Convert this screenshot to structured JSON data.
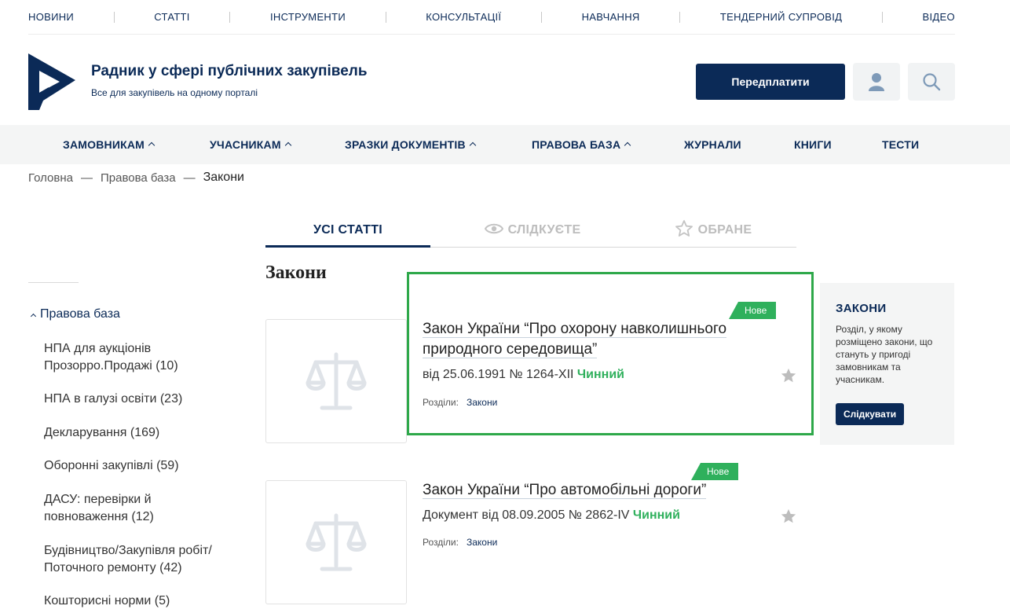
{
  "topnav": [
    "НОВИНИ",
    "СТАТТІ",
    "ІНСТРУМЕНТИ",
    "КОНСУЛЬТАЦІЇ",
    "НАВЧАННЯ",
    "ТЕНДЕРНИЙ СУПРОВІД",
    "ВІДЕО"
  ],
  "header": {
    "title": "Радник у сфері публічних закупівель",
    "subtitle": "Все для закупівель на одному порталі",
    "subscribe_label": "Передплатити"
  },
  "mainnav": [
    "ЗАМОВНИКАМ",
    "УЧАСНИКАМ",
    "ЗРАЗКИ ДОКУМЕНТІВ",
    "ПРАВОВА БАЗА",
    "ЖУРНАЛИ",
    "КНИГИ",
    "ТЕСТИ"
  ],
  "breadcrumb": {
    "home": "Головна",
    "section": "Правова база",
    "current": "Закони",
    "separator": "—"
  },
  "tabs": {
    "all": "УСІ СТАТТІ",
    "following": "СЛІДКУЄТЕ",
    "favorites": "ОБРАНЕ"
  },
  "section_title": "Закони",
  "sidebar": {
    "root": "Правова база",
    "items": [
      "НПА для аукціонів Прозорро.Продажі (10)",
      "НПА в галузі освіти (23)",
      "Декларування (169)",
      "Оборонні закупівлі (59)",
      "ДАСУ: перевірки й повноваження (12)",
      "Будівництво/Закупівля робіт/ Поточного ремонту (42)",
      "Кошторисні норми (5)"
    ]
  },
  "articles": [
    {
      "badge": "Нове",
      "title": "Закон України “Про охорону навколишнього природного середовища”",
      "meta": "від 25.06.1991 № 1264-XII",
      "status": "Чинний",
      "sections_label": "Розділи:",
      "section": "Закони"
    },
    {
      "badge": "Нове",
      "title": "Закон України “Про автомобільні дороги”",
      "meta": "Документ від 08.09.2005 № 2862-IV",
      "status": "Чинний",
      "sections_label": "Розділи:",
      "section": "Закони"
    }
  ],
  "infobox": {
    "title": "ЗАКОНИ",
    "text": "Розділ, у якому розміщено закони, що стануть у пригоді замовникам та учасникам.",
    "button": "Слідкувати"
  },
  "colors": {
    "brand": "#0b2a57",
    "accent_green": "#2fb05c",
    "highlight": "#2ea84a"
  }
}
